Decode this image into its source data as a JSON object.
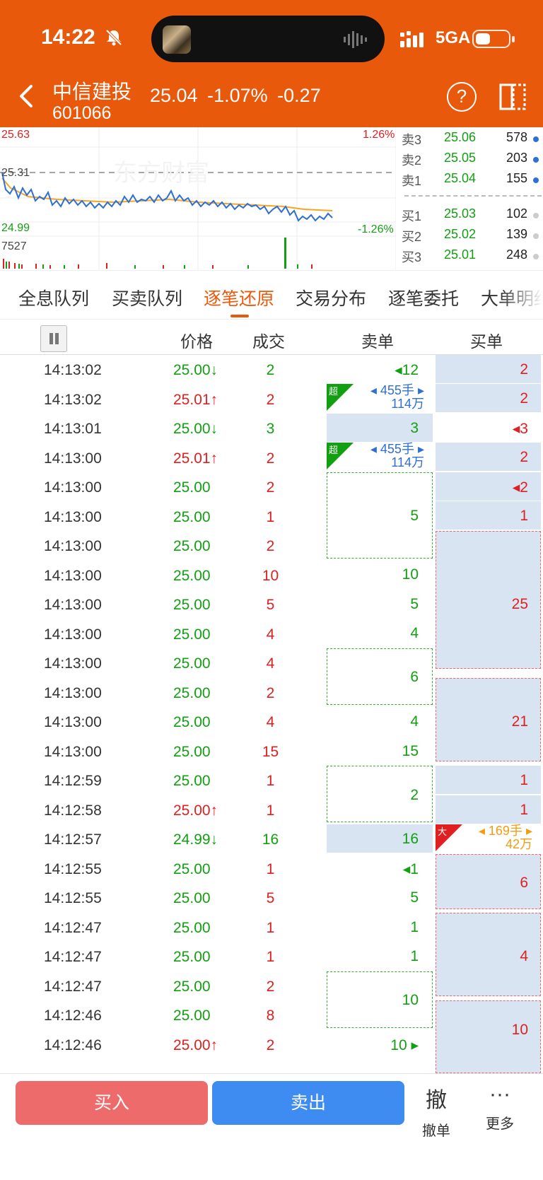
{
  "status": {
    "time": "14:22",
    "network": "5GA"
  },
  "header": {
    "name": "中信建投",
    "code": "601066",
    "price": "25.04",
    "change_pct": "-1.07%",
    "change": "-0.27"
  },
  "chart": {
    "high": "25.63",
    "prev_close": "25.31",
    "low": "24.99",
    "high_pct": "1.26%",
    "low_pct": "-1.26%",
    "volume_max": "7527",
    "watermark": "东方财富"
  },
  "order_book": {
    "asks": [
      {
        "label": "卖3",
        "price": "25.06",
        "vol": "578"
      },
      {
        "label": "卖2",
        "price": "25.05",
        "vol": "203"
      },
      {
        "label": "卖1",
        "price": "25.04",
        "vol": "155"
      }
    ],
    "bids": [
      {
        "label": "买1",
        "price": "25.03",
        "vol": "102"
      },
      {
        "label": "买2",
        "price": "25.02",
        "vol": "139"
      },
      {
        "label": "买3",
        "price": "25.01",
        "vol": "248"
      }
    ]
  },
  "tabs": [
    "全息队列",
    "买卖队列",
    "逐笔还原",
    "交易分布",
    "逐笔委托",
    "大单明细"
  ],
  "active_tab": 2,
  "columns": {
    "price": "价格",
    "volume": "成交",
    "sell": "卖单",
    "buy": "买单"
  },
  "trades": [
    {
      "time": "14:13:02",
      "price": "25.00↓",
      "vol": "2"
    },
    {
      "time": "14:13:02",
      "price": "25.01↑",
      "vol": "2"
    },
    {
      "time": "14:13:01",
      "price": "25.00↓",
      "vol": "3"
    },
    {
      "time": "14:13:00",
      "price": "25.01↑",
      "vol": "2"
    },
    {
      "time": "14:13:00",
      "price": "25.00",
      "vol": "2"
    },
    {
      "time": "14:13:00",
      "price": "25.00",
      "vol": "1"
    },
    {
      "time": "14:13:00",
      "price": "25.00",
      "vol": "2"
    },
    {
      "time": "14:13:00",
      "price": "25.00",
      "vol": "10"
    },
    {
      "time": "14:13:00",
      "price": "25.00",
      "vol": "5"
    },
    {
      "time": "14:13:00",
      "price": "25.00",
      "vol": "4"
    },
    {
      "time": "14:13:00",
      "price": "25.00",
      "vol": "4"
    },
    {
      "time": "14:13:00",
      "price": "25.00",
      "vol": "2"
    },
    {
      "time": "14:13:00",
      "price": "25.00",
      "vol": "4"
    },
    {
      "time": "14:13:00",
      "price": "25.00",
      "vol": "15"
    },
    {
      "time": "14:12:59",
      "price": "25.00",
      "vol": "1"
    },
    {
      "time": "14:12:58",
      "price": "25.00↑",
      "vol": "1"
    },
    {
      "time": "14:12:57",
      "price": "24.99↓",
      "vol": "16"
    },
    {
      "time": "14:12:55",
      "price": "25.00",
      "vol": "1"
    },
    {
      "time": "14:12:55",
      "price": "25.00",
      "vol": "5"
    },
    {
      "time": "14:12:47",
      "price": "25.00",
      "vol": "1"
    },
    {
      "time": "14:12:47",
      "price": "25.00",
      "vol": "1"
    },
    {
      "time": "14:12:47",
      "price": "25.00",
      "vol": "2"
    },
    {
      "time": "14:12:46",
      "price": "25.00",
      "vol": "8"
    },
    {
      "time": "14:12:46",
      "price": "25.00↑",
      "vol": "2"
    }
  ],
  "sell_orders": {
    "r0": "◂12",
    "r2": "3",
    "r4": "5",
    "r7": "10",
    "r8": "5",
    "r9": "4",
    "r10": "6",
    "r12": "4",
    "r13": "15",
    "r14": "2",
    "r16": "16",
    "r17": "◂1",
    "r18": "5",
    "r19": "1",
    "r20": "1",
    "r21": "10",
    "r23": "10 ▸"
  },
  "buy_orders": {
    "r0": "2",
    "r1": "2",
    "r2": "◂3",
    "r3": "2",
    "r4": "◂2",
    "r5": "1",
    "r8": "25",
    "r12": "21",
    "r14": "1",
    "r15": "1",
    "r17": "6",
    "r20": "4",
    "r22": "10"
  },
  "big_orders": {
    "super_tag": "超",
    "super_hands": "455手",
    "super_amount": "114万",
    "large_tag": "大",
    "large_hands": "169手",
    "large_amount": "42万"
  },
  "bottom": {
    "buy": "买入",
    "sell": "卖出",
    "cancel_icon": "撤",
    "cancel": "撤单",
    "more": "更多"
  },
  "colors": {
    "brand": "#e8590c",
    "up": "#e02020",
    "down": "#12a012",
    "buy_button": "#ee6b6b",
    "sell_button": "#3e8cf2"
  }
}
